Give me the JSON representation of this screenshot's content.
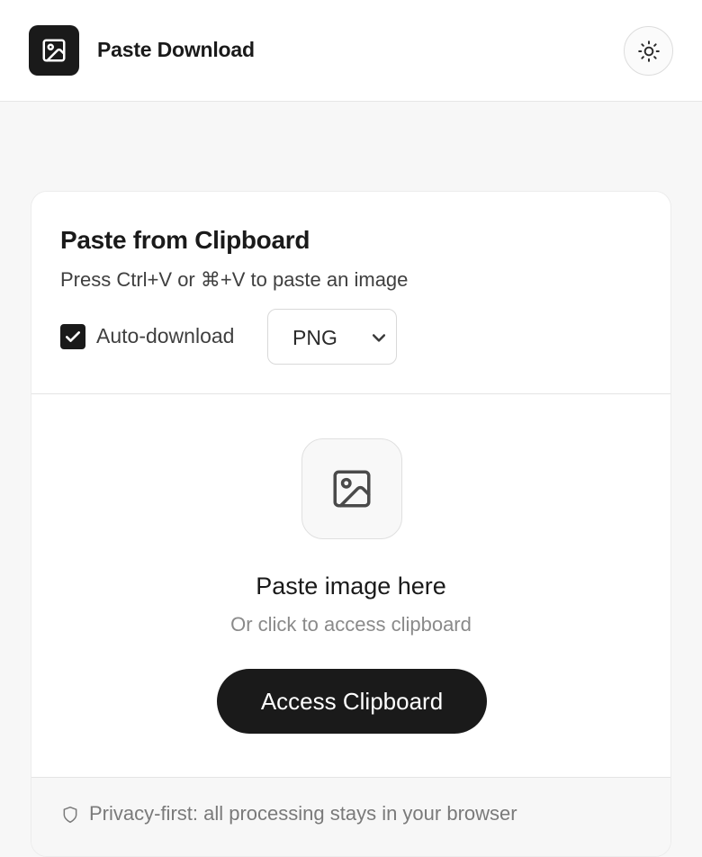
{
  "header": {
    "app_title": "Paste Download",
    "logo_icon": "image-icon",
    "theme_toggle_icon": "sun-icon"
  },
  "card": {
    "title": "Paste from Clipboard",
    "subtitle": "Press Ctrl+V or ⌘+V to paste an image",
    "auto_download": {
      "label": "Auto-download",
      "checked": true
    },
    "format_select": {
      "value": "PNG"
    }
  },
  "dropzone": {
    "icon": "image-icon",
    "title": "Paste image here",
    "subtitle": "Or click to access clipboard",
    "button_label": "Access Clipboard"
  },
  "footer": {
    "icon": "shield-icon",
    "text": "Privacy-first: all processing stays in your browser"
  },
  "colors": {
    "accent": "#1a1a1a",
    "background": "#f7f7f7",
    "card": "#ffffff",
    "muted_text": "#8a8a8a"
  }
}
